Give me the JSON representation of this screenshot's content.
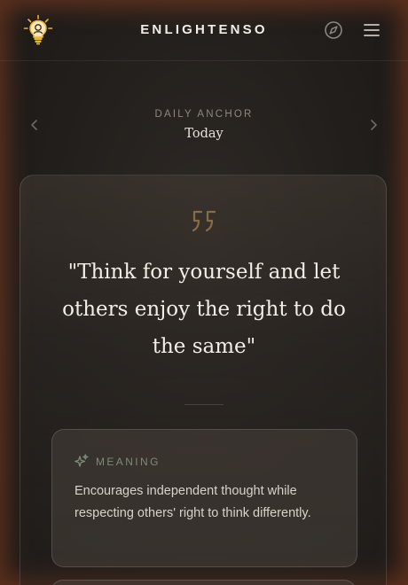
{
  "header": {
    "brand": "ENLIGHTENSO",
    "logo_icon": "lightbulb-icon",
    "compass_icon": "compass-icon",
    "menu_icon": "hamburger-menu-icon"
  },
  "day_nav": {
    "eyebrow": "DAILY ANCHOR",
    "date_label": "Today",
    "prev_icon": "chevron-left-icon",
    "next_icon": "chevron-right-icon"
  },
  "quote": {
    "icon": "quote-icon",
    "text": "\"Think for yourself and let others enjoy the right to do the same\""
  },
  "meaning": {
    "icon": "sparkle-icon",
    "title": "MEANING",
    "text": "Encourages independent thought while respecting others' right to think differently."
  },
  "colors": {
    "accent_bronze": "#8a6a48",
    "glow": "#964422",
    "meaning_label": "#7d8a77",
    "text_primary": "#f2ede7"
  }
}
